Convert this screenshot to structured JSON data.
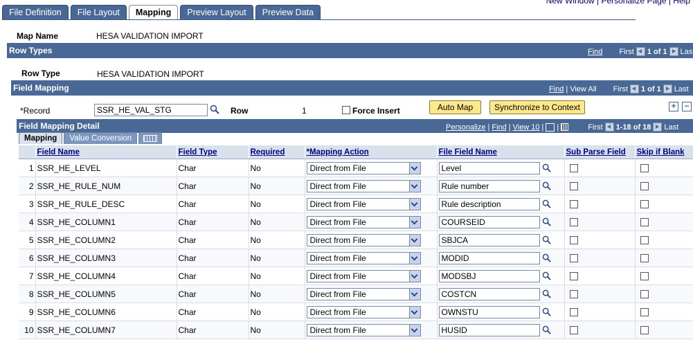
{
  "top_links": "New Window | Personalize Page | Help",
  "tabs": [
    {
      "label": "File Definition",
      "active": false
    },
    {
      "label": "File Layout",
      "active": false
    },
    {
      "label": "Mapping",
      "active": true
    },
    {
      "label": "Preview Layout",
      "active": false
    },
    {
      "label": "Preview Data",
      "active": false
    }
  ],
  "map_name": {
    "label": "Map Name",
    "value": "HESA VALIDATION IMPORT"
  },
  "row_types": {
    "title": "Row Types",
    "find": "Find",
    "first": "First",
    "range": "1 of 1",
    "last": "Last",
    "row_type_label": "Row Type",
    "row_type_value": "HESA VALIDATION IMPORT"
  },
  "field_mapping": {
    "title": "Field Mapping",
    "find": "Find",
    "view_all": "View All",
    "first": "First",
    "range": "1 of 1",
    "last": "Last",
    "record_label": "*Record",
    "record_value": "SSR_HE_VAL_STG",
    "row_label": "Row",
    "row_value": "1",
    "force_insert": "Force Insert",
    "auto_map": "Auto Map",
    "sync": "Synchronize to Context"
  },
  "detail": {
    "title": "Field Mapping Detail",
    "personalize": "Personalize",
    "find": "Find",
    "view10": "View 10",
    "first": "First",
    "range": "1-18 of 18",
    "last": "Last",
    "subtabs": [
      "Mapping",
      "Value Conversion"
    ],
    "headers": [
      "Field Name",
      "Field Type",
      "Required",
      "*Mapping Action",
      "File Field Name",
      "Sub Parse Field",
      "Skip if Blank"
    ],
    "rows": [
      {
        "n": "1",
        "field": "SSR_HE_LEVEL",
        "type": "Char",
        "req": "No",
        "action": "Direct from File",
        "file": "Level"
      },
      {
        "n": "2",
        "field": "SSR_HE_RULE_NUM",
        "type": "Char",
        "req": "No",
        "action": "Direct from File",
        "file": "Rule number"
      },
      {
        "n": "3",
        "field": "SSR_HE_RULE_DESC",
        "type": "Char",
        "req": "No",
        "action": "Direct from File",
        "file": "Rule description"
      },
      {
        "n": "4",
        "field": "SSR_HE_COLUMN1",
        "type": "Char",
        "req": "No",
        "action": "Direct from File",
        "file": "COURSEID"
      },
      {
        "n": "5",
        "field": "SSR_HE_COLUMN2",
        "type": "Char",
        "req": "No",
        "action": "Direct from File",
        "file": "SBJCA"
      },
      {
        "n": "6",
        "field": "SSR_HE_COLUMN3",
        "type": "Char",
        "req": "No",
        "action": "Direct from File",
        "file": "MODID"
      },
      {
        "n": "7",
        "field": "SSR_HE_COLUMN4",
        "type": "Char",
        "req": "No",
        "action": "Direct from File",
        "file": "MODSBJ"
      },
      {
        "n": "8",
        "field": "SSR_HE_COLUMN5",
        "type": "Char",
        "req": "No",
        "action": "Direct from File",
        "file": "COSTCN"
      },
      {
        "n": "9",
        "field": "SSR_HE_COLUMN6",
        "type": "Char",
        "req": "No",
        "action": "Direct from File",
        "file": "OWNSTU"
      },
      {
        "n": "10",
        "field": "SSR_HE_COLUMN7",
        "type": "Char",
        "req": "No",
        "action": "Direct from File",
        "file": "HUSID"
      }
    ]
  }
}
